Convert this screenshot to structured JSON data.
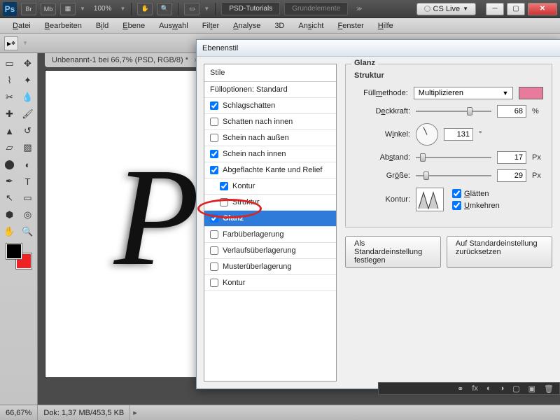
{
  "titlebar": {
    "zoom": "100%",
    "tab1": "PSD-Tutorials",
    "tab2": "Grundelemente",
    "cslive": "CS Live",
    "btns": {
      "br": "Br",
      "mb": "Mb"
    }
  },
  "menu": {
    "datei": "Datei",
    "bearbeiten": "Bearbeiten",
    "bild": "Bild",
    "ebene": "Ebene",
    "auswahl": "Auswahl",
    "filter": "Filter",
    "analyse": "Analyse",
    "dD": "3D",
    "ansicht": "Ansicht",
    "fenster": "Fenster",
    "hilfe": "Hilfe"
  },
  "doc": {
    "tab": "Unbenannt-1 bei 66,7% (PSD, RGB/8) *"
  },
  "status": {
    "zoom": "66,67%",
    "dok": "Dok: 1,37 MB/453,5 KB"
  },
  "dialog": {
    "title": "Ebenenstil",
    "styles_header": "Stile",
    "fill_opts": "Fülloptionen: Standard",
    "items": {
      "schlagschatten": "Schlagschatten",
      "schatten_innen": "Schatten nach innen",
      "schein_aussen": "Schein nach außen",
      "schein_innen": "Schein nach innen",
      "abgeflachte": "Abgeflachte Kante und Relief",
      "kontur": "Kontur",
      "struktur": "Struktur",
      "glanz": "Glanz",
      "farb": "Farbüberlagerung",
      "verlauf": "Verlaufsüberlagerung",
      "muster": "Musterüberlagerung",
      "kontur2": "Kontur"
    },
    "panel_title": "Glanz",
    "struktur": "Struktur",
    "labels": {
      "fuellmethode": "Füllmethode:",
      "deckkraft": "Deckkraft:",
      "winkel": "Winkel:",
      "abstand": "Abstand:",
      "groesse": "Größe:",
      "kontur": "Kontur:"
    },
    "fuellmethode_val": "Multiplizieren",
    "deckkraft": "68",
    "deckkraft_unit": "%",
    "winkel": "131",
    "winkel_unit": "°",
    "abstand": "17",
    "abstand_unit": "Px",
    "groesse": "29",
    "groesse_unit": "Px",
    "glaetten": "Glätten",
    "umkehren": "Umkehren",
    "btn_default": "Als Standardeinstellung festlegen",
    "btn_reset": "Auf Standardeinstellung zurücksetzen"
  }
}
